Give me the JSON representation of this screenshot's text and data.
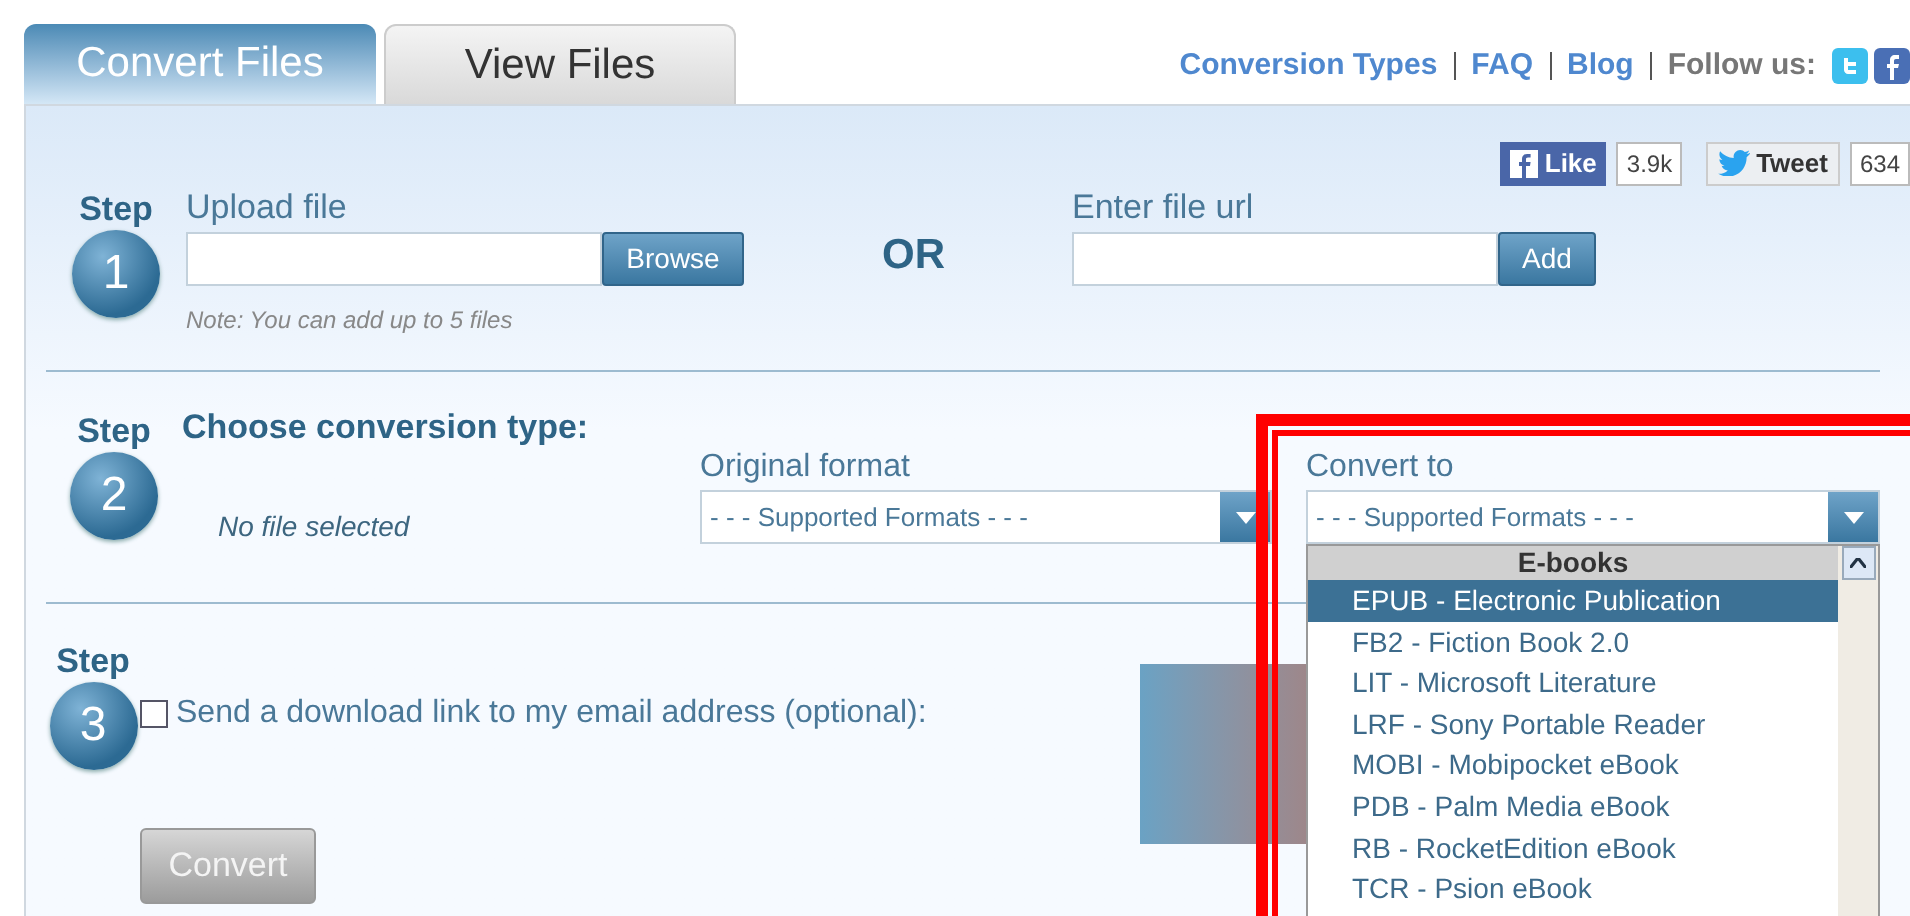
{
  "tabs": [
    {
      "label": "Convert Files",
      "selected": true
    },
    {
      "label": "View Files",
      "selected": false
    }
  ],
  "nav": {
    "links": [
      "Conversion Types",
      "FAQ",
      "Blog"
    ],
    "follow_label": "Follow us:"
  },
  "social": [
    {
      "kind": "facebook",
      "label": "Like",
      "count": "3.9k"
    },
    {
      "kind": "twitter",
      "label": "Tweet",
      "count": "634"
    }
  ],
  "step1": {
    "step_label": "Step",
    "number": "1",
    "upload_label": "Upload file",
    "browse_button": "Browse",
    "note": "Note: You can add up to 5 files",
    "or_label": "OR",
    "url_label": "Enter file url",
    "add_button": "Add"
  },
  "step2": {
    "step_label": "Step",
    "number": "2",
    "title": "Choose conversion type:",
    "no_file": "No file selected",
    "original_label": "Original format",
    "original_value": "- - - Supported Formats - - -",
    "convert_label": "Convert to",
    "convert_value": "- - - Supported Formats - - -",
    "dropdown": {
      "group": "E-books",
      "options": [
        {
          "label": "EPUB - Electronic Publication",
          "selected": true
        },
        {
          "label": "FB2 - Fiction Book 2.0",
          "selected": false
        },
        {
          "label": "LIT - Microsoft Literature",
          "selected": false
        },
        {
          "label": "LRF - Sony Portable Reader",
          "selected": false
        },
        {
          "label": "MOBI - Mobipocket eBook",
          "selected": false
        },
        {
          "label": "PDB - Palm Media eBook",
          "selected": false
        },
        {
          "label": "RB - RocketEdition eBook",
          "selected": false
        },
        {
          "label": "TCR - Psion eBook",
          "selected": false
        }
      ]
    }
  },
  "step3": {
    "step_label": "Step",
    "number": "3",
    "email_checkbox": {
      "label": "Send a download link to my email address (optional):",
      "checked": false
    },
    "convert_button": "Convert",
    "convert_disabled": true
  }
}
